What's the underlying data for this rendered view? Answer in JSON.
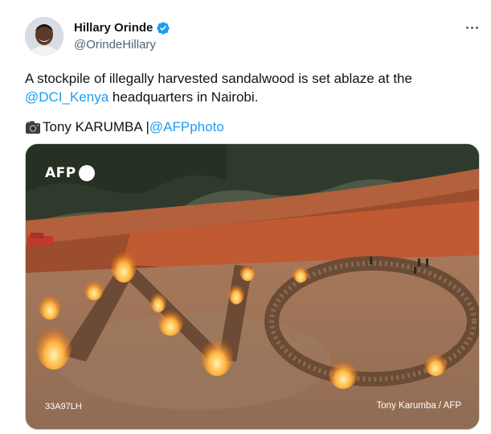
{
  "author": {
    "display_name": "Hillary Orinde",
    "handle": "@OrindeHillary",
    "verified": true
  },
  "tweet": {
    "text_line1": "A stockpile of illegally harvested sandalwood is set ablaze at the",
    "mention": "@DCI_Kenya",
    "text_line2_rest": " headquarters in Nairobi.",
    "credit_name": "Tony KARUMBA | ",
    "credit_handle": "@AFPphoto"
  },
  "media": {
    "watermark": "AFP",
    "photo_id": "33A97LH",
    "photo_credit": "Tony Karumba / AFP"
  },
  "icons": {
    "more": "more-horizontal-icon",
    "verified": "verified-badge-icon",
    "camera": "camera-icon"
  },
  "colors": {
    "link": "#1d9bf0",
    "verified": "#1d9bf0",
    "secondary_text": "#536471"
  }
}
